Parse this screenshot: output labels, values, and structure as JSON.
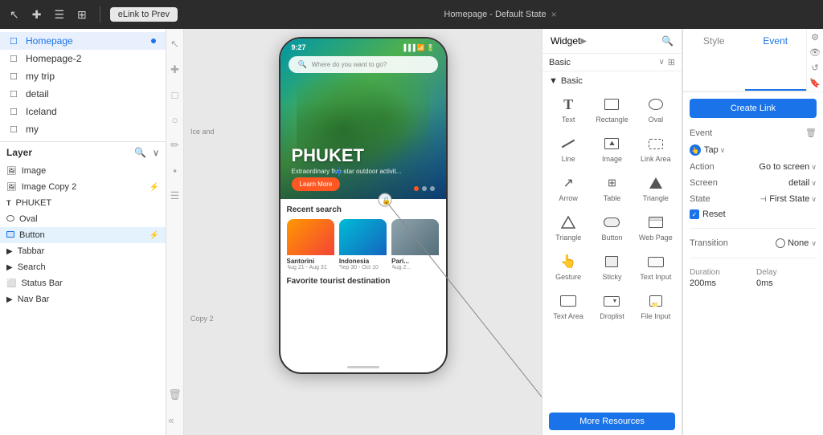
{
  "toolbar": {
    "link_btn": "eLink to Prev",
    "page_label": "Homepage - Default State",
    "close_icon": "×"
  },
  "left_tools": {
    "tools": [
      "↖",
      "✚",
      "☐",
      "○",
      "✎",
      "⬛",
      "☰"
    ]
  },
  "nav": {
    "items": [
      {
        "label": "Homepage",
        "active": true,
        "has_dot": true,
        "icon_type": "page"
      },
      {
        "label": "Homepage-2",
        "active": false,
        "has_dot": false,
        "icon_type": "page"
      },
      {
        "label": "my trip",
        "active": false,
        "has_dot": false,
        "icon_type": "page"
      },
      {
        "label": "detail",
        "active": false,
        "has_dot": false,
        "icon_type": "page"
      },
      {
        "label": "Iceland",
        "active": false,
        "has_dot": false,
        "icon_type": "page"
      },
      {
        "label": "my",
        "active": false,
        "has_dot": false,
        "icon_type": "page"
      }
    ]
  },
  "layer_panel": {
    "title": "Layer",
    "items": [
      {
        "label": "Image",
        "type": "image",
        "has_lightning": false
      },
      {
        "label": "Image Copy 2",
        "type": "image",
        "has_lightning": true,
        "lightning_color": "orange"
      },
      {
        "label": "PHUKET",
        "type": "text"
      },
      {
        "label": "Oval",
        "type": "oval"
      },
      {
        "label": "Button",
        "type": "rect",
        "active": true,
        "has_lightning": true,
        "lightning_color": "blue"
      },
      {
        "label": "Tabbar",
        "type": "folder"
      },
      {
        "label": "Search",
        "type": "folder"
      },
      {
        "label": "Status Bar",
        "type": "image"
      },
      {
        "label": "Nav Bar",
        "type": "folder"
      }
    ]
  },
  "phone": {
    "time": "9:27",
    "hero_title": "PHUKET",
    "hero_subtitle": "Extraordinary five-star outdoor activit...",
    "search_placeholder": "Where do you want to go?",
    "learn_more": "Learn More",
    "recent_search": "Recent search",
    "cards": [
      {
        "name": "Santorini",
        "date": "Aug 21 - Aug 31"
      },
      {
        "name": "Indonesia",
        "date": "Sep 30 - Oct 10"
      },
      {
        "name": "Pari...",
        "date": "Aug 2..."
      }
    ],
    "fav_title": "Favorite tourist destination"
  },
  "widget_panel": {
    "title": "Widget",
    "filter": "Basic",
    "section_title": "Basic",
    "items": [
      {
        "label": "Text",
        "type": "text"
      },
      {
        "label": "Rectangle",
        "type": "rect"
      },
      {
        "label": "Oval",
        "type": "oval"
      },
      {
        "label": "Line",
        "type": "line"
      },
      {
        "label": "Image",
        "type": "image"
      },
      {
        "label": "Link Area",
        "type": "linkarea"
      },
      {
        "label": "Arrow",
        "type": "arrow"
      },
      {
        "label": "Table",
        "type": "table"
      },
      {
        "label": "Triangle",
        "type": "triangle"
      },
      {
        "label": "Triangle",
        "type": "triangle2"
      },
      {
        "label": "Button",
        "type": "button"
      },
      {
        "label": "Web Page",
        "type": "webpage"
      },
      {
        "label": "Gesture",
        "type": "gesture"
      },
      {
        "label": "Sticky",
        "type": "sticky"
      },
      {
        "label": "Text Input",
        "type": "textinput"
      },
      {
        "label": "Text Area",
        "type": "textarea"
      },
      {
        "label": "Droplist",
        "type": "droplist"
      },
      {
        "label": "File Input",
        "type": "fileinput"
      }
    ],
    "more_btn": "More Resources"
  },
  "right_panel": {
    "tabs": [
      "Style",
      "Event"
    ],
    "active_tab": "Event",
    "create_link_btn": "Create Link",
    "event_label": "Event",
    "event_type": "Tap",
    "action_label": "Action",
    "action_value": "Go to screen",
    "screen_label": "Screen",
    "screen_value": "detail",
    "state_label": "State",
    "state_value": "First State",
    "reset_label": "Reset",
    "transition_label": "Transition",
    "transition_value": "None",
    "duration_label": "Duration",
    "duration_value": "200ms",
    "delay_label": "Delay",
    "delay_value": "0ms"
  },
  "canvas_labels": {
    "ice_and": "Ice and",
    "copy2": "Copy 2"
  }
}
